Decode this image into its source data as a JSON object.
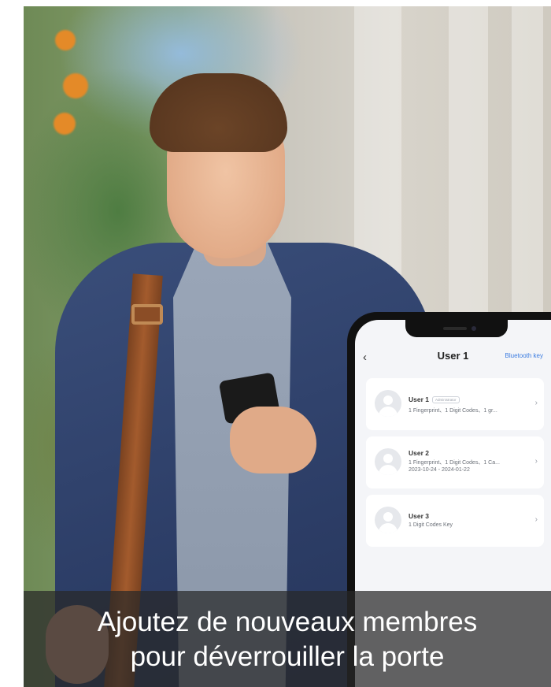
{
  "phone_app": {
    "header": {
      "back_icon": "chevron-left-icon",
      "title": "User 1",
      "action_label": "Bluetooth key",
      "accent_color": "#3a7be0"
    },
    "users": [
      {
        "name": "User 1",
        "role": "Administrator",
        "detail": "1 Fingerprint、1 Digit Codes、1 gr...",
        "validity": ""
      },
      {
        "name": "User 2",
        "role": "",
        "detail": "1 Fingerprint、1 Digit Codes、1 Ca...",
        "validity": "2023-10-24 - 2024-01-22"
      },
      {
        "name": "User 3",
        "role": "",
        "detail": "1 Digit Codes Key",
        "validity": ""
      }
    ],
    "primary_color": "#2e63c8"
  },
  "caption": {
    "line1": "Ajoutez de nouveaux membres",
    "line2": "pour déverrouiller la porte"
  }
}
